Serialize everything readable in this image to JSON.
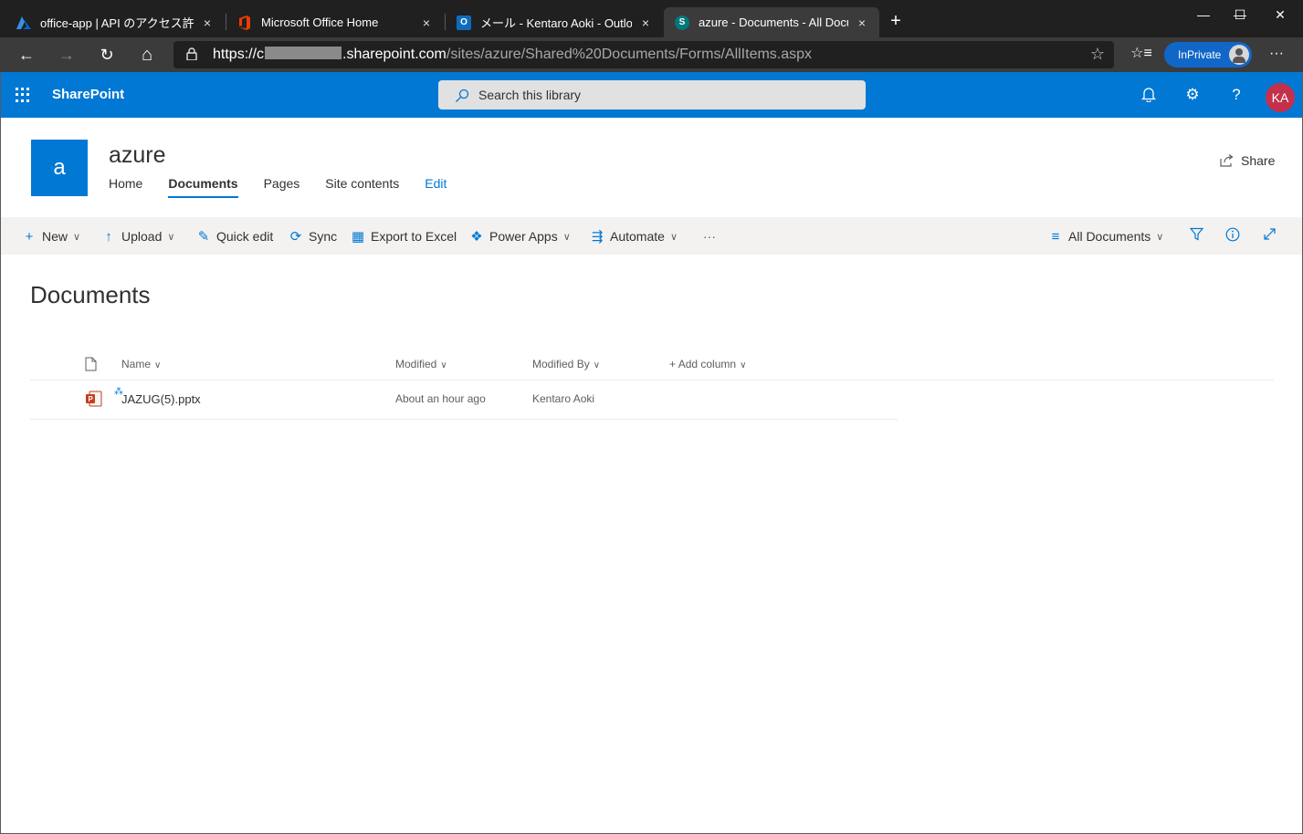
{
  "browser": {
    "tabs": [
      {
        "title": "office-app | API のアクセス許可 - M",
        "close": "×",
        "active": false
      },
      {
        "title": "Microsoft Office Home",
        "close": "×",
        "active": false
      },
      {
        "title": "メール - Kentaro Aoki - Outlook",
        "close": "×",
        "active": false
      },
      {
        "title": "azure - Documents - All Docume",
        "close": "×",
        "active": true
      }
    ],
    "new_tab": "+",
    "window_controls": {
      "minimize": "—",
      "maximize": "☐",
      "close": "✕"
    },
    "nav": {
      "back": "←",
      "forward": "→",
      "refresh": "↻",
      "home": "⌂"
    },
    "url": {
      "scheme": "https://",
      "host_prefix": "c",
      "host_suffix": ".sharepoint.com",
      "path": "/sites/azure/Shared%20Documents/Forms/AllItems.aspx"
    },
    "favorite_star": "☆",
    "favorites": "☆≡",
    "inprivate_label": "InPrivate",
    "more": "···"
  },
  "suite": {
    "brand": "SharePoint",
    "search_placeholder": "Search this library",
    "user_initials": "KA",
    "avatar_color": "#c4314b",
    "accent": "#0078d4"
  },
  "site": {
    "logo_letter": "a",
    "title": "azure",
    "nav": [
      "Home",
      "Documents",
      "Pages",
      "Site contents",
      "Edit"
    ],
    "share_label": "Share"
  },
  "commands": {
    "new": "New",
    "upload": "Upload",
    "quick_edit": "Quick edit",
    "sync": "Sync",
    "export": "Export to Excel",
    "power_apps": "Power Apps",
    "automate": "Automate",
    "overflow": "···",
    "view": "All Documents"
  },
  "library": {
    "title": "Documents",
    "columns": {
      "name": "Name",
      "modified": "Modified",
      "modified_by": "Modified By",
      "add_column": "Add column"
    },
    "rows": [
      {
        "name": "JAZUG(5).pptx",
        "modified": "About an hour ago",
        "modified_by": "Kentaro Aoki"
      }
    ]
  }
}
